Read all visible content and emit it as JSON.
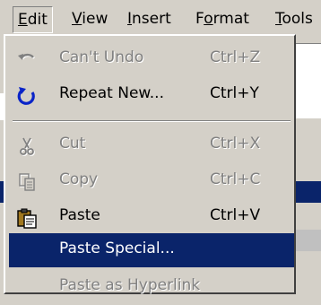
{
  "menubar": {
    "items": [
      {
        "label": "Edit"
      },
      {
        "label": "View"
      },
      {
        "label": "Insert"
      },
      {
        "label": "Format"
      },
      {
        "label": "Tools"
      }
    ]
  },
  "edit_menu": {
    "items": [
      {
        "label": "Can't Undo",
        "shortcut": "Ctrl+Z",
        "icon": "undo-icon",
        "enabled": false
      },
      {
        "label": "Repeat New...",
        "shortcut": "Ctrl+Y",
        "icon": "repeat-icon",
        "enabled": true
      },
      {
        "label": "Cut",
        "shortcut": "Ctrl+X",
        "icon": "scissors-icon",
        "enabled": false
      },
      {
        "label": "Copy",
        "shortcut": "Ctrl+C",
        "icon": "copy-icon",
        "enabled": false
      },
      {
        "label": "Paste",
        "shortcut": "Ctrl+V",
        "icon": "clipboard-icon",
        "enabled": true
      },
      {
        "label": "Paste Special...",
        "shortcut": "",
        "enabled": true,
        "highlighted": true
      },
      {
        "label": "Paste as Hyperlink",
        "shortcut": "",
        "enabled": false
      }
    ]
  },
  "colors": {
    "face": "#d4d0c8",
    "highlight": "#0a246a",
    "disabled": "#808080",
    "repeat_icon": "#0a24c8"
  }
}
